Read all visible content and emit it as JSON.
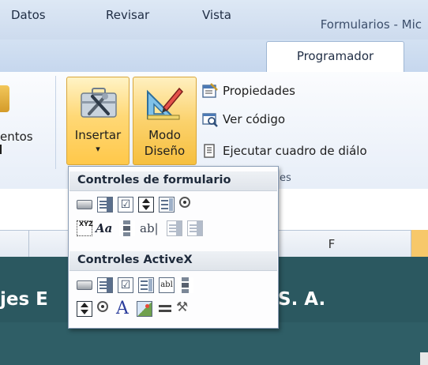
{
  "window": {
    "title": "Formularios - Mic"
  },
  "tabs": [
    {
      "label": "Datos"
    },
    {
      "label": "Revisar"
    },
    {
      "label": "Vista"
    },
    {
      "label": "Programador"
    }
  ],
  "ribbon": {
    "left_group_label": "entos",
    "insertar": {
      "line1": "Insertar",
      "arrow": "▾"
    },
    "modo": {
      "line1": "Modo",
      "line2": "Diseño"
    },
    "commands": {
      "propiedades": "Propiedades",
      "ver_codigo": "Ver código",
      "ejecutar": "Ejecutar cuadro de diálo"
    },
    "group_label_tail": "es"
  },
  "dropdown": {
    "form_controls_header": "Controles de formulario",
    "activex_header": "Controles ActiveX",
    "form_controls_row1": [
      "button-icon",
      "combo-box-icon",
      "check-box-icon",
      "spin-button-icon",
      "list-box-icon",
      "option-button-icon"
    ],
    "form_controls_row2": [
      "group-box-icon",
      "label-icon",
      "scroll-bar-icon",
      "text-field-icon",
      "combo-list-edit-icon",
      "combo-drop-down-edit-icon"
    ],
    "label_glyph": "Aa",
    "text_field_glyph": "ab|",
    "abl_glyph": "abl",
    "big_a_glyph": "A",
    "check_glyph": "☑",
    "group_box_glyph": "XYZ",
    "tools_glyph": "⚒"
  },
  "sheet": {
    "column_F": "F",
    "text_left": "jes E",
    "text_right": "S. A."
  },
  "colors": {
    "ribbon_highlight": "#ffd876",
    "sheet_background": "#2b5860",
    "selected_column": "#f7c86a"
  }
}
